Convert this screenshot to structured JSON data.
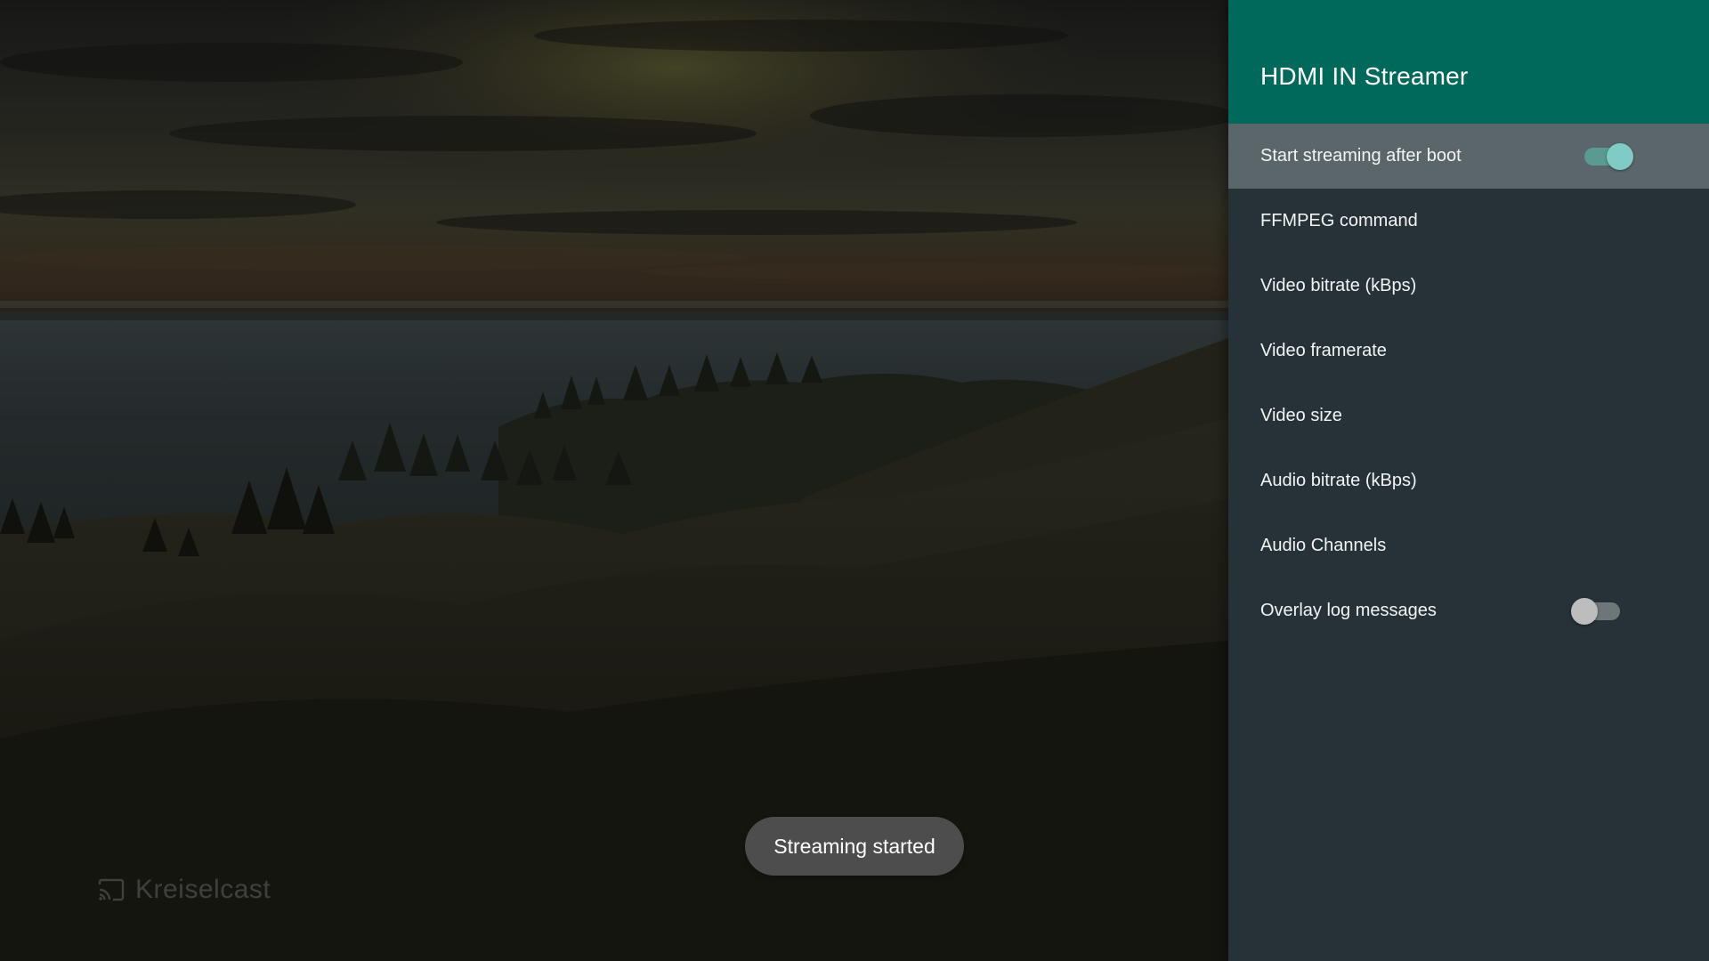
{
  "app": {
    "brand_name": "Kreiselcast",
    "brand_icon": "cast-icon"
  },
  "toast": {
    "message": "Streaming started"
  },
  "panel": {
    "title": "HDMI IN Streamer",
    "header_color": "#00695c",
    "background_color": "#263238",
    "items": [
      {
        "label": "Start streaming after boot",
        "has_switch": true,
        "switch_on": true,
        "focused": true
      },
      {
        "label": "FFMPEG command",
        "has_switch": false
      },
      {
        "label": "Video bitrate (kBps)",
        "has_switch": false
      },
      {
        "label": "Video framerate",
        "has_switch": false
      },
      {
        "label": "Video size",
        "has_switch": false
      },
      {
        "label": "Audio bitrate (kBps)",
        "has_switch": false
      },
      {
        "label": "Audio Channels",
        "has_switch": false
      },
      {
        "label": "Overlay log messages",
        "has_switch": true,
        "switch_on": false
      }
    ],
    "accent_color": "#80cbc4"
  }
}
